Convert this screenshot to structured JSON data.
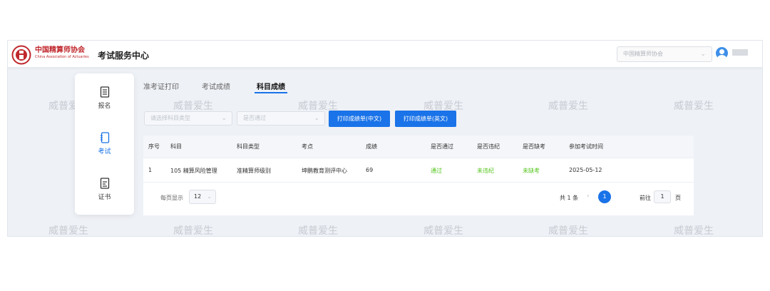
{
  "header": {
    "brand_cn": "中国精算师协会",
    "brand_en": "China Association of Actuaries",
    "system_title": "考试服务中心",
    "org_select": "中国精算师协会",
    "accent": "#1a73e8",
    "brand_color": "#c0282d"
  },
  "sidebar": {
    "items": [
      {
        "label": "报名",
        "icon": "document-list-icon"
      },
      {
        "label": "考试",
        "icon": "notebook-icon"
      },
      {
        "label": "证书",
        "icon": "certificate-icon"
      }
    ]
  },
  "tabs": [
    {
      "label": "准考证打印"
    },
    {
      "label": "考试成绩"
    },
    {
      "label": "科目成绩"
    }
  ],
  "filters": {
    "subject_type_placeholder": "请选择科目类型",
    "passed_placeholder": "是否通过"
  },
  "buttons": {
    "print_cn": "打印成绩单(中文)",
    "print_en": "打印成绩单(英文)"
  },
  "table": {
    "columns": [
      "序号",
      "科目",
      "科目类型",
      "考点",
      "成绩",
      "是否通过",
      "是否违纪",
      "是否缺考",
      "参加考试时间"
    ],
    "rows": [
      {
        "index": "1",
        "subject": "105 精算风险管理",
        "subject_type": "准精算师级别",
        "center": "坤鹏教育测评中心",
        "score": "69",
        "passed": "通过",
        "violation": "未违纪",
        "absent": "未缺考",
        "date": "2025-05-12"
      }
    ]
  },
  "pagination": {
    "per_page_label": "每页显示",
    "per_page": "12",
    "total": "共 1 条",
    "current_page": "1",
    "goto_label": "前往",
    "goto_value": "1",
    "goto_unit": "页"
  },
  "watermark": "威普爱生"
}
